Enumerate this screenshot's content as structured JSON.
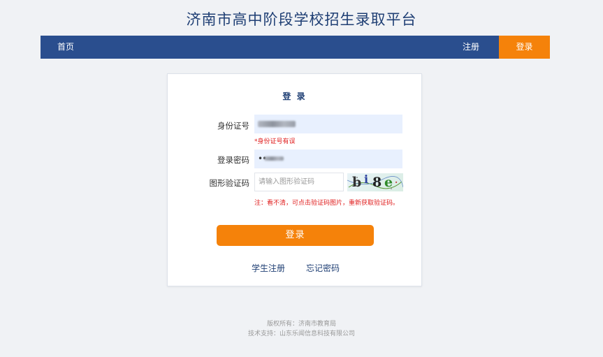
{
  "site": {
    "title": "济南市高中阶段学校招生录取平台"
  },
  "nav": {
    "home": "首页",
    "register": "注册",
    "login": "登录"
  },
  "form": {
    "title": "登 录",
    "id_label": "身份证号",
    "id_error": "*身份证号有误",
    "password_label": "登录密码",
    "password_mask": "••",
    "captcha_label": "图形验证码",
    "captcha_placeholder": "请输入图形验证码",
    "captcha_chars": [
      "b",
      "i",
      "8",
      "e",
      "·"
    ],
    "captcha_hint": "注：看不清，可点击验证码图片，重新获取验证码。",
    "submit_label": "登录",
    "student_register": "学生注册",
    "forgot_password": "忘记密码"
  },
  "footer": {
    "copyright": "版权所有：济南市教育局",
    "support": "技术支持：山东乐闻信息科技有限公司"
  },
  "colors": {
    "brand_blue": "#2a4e8e",
    "accent_orange": "#f5820a",
    "error_red": "#e02020"
  }
}
